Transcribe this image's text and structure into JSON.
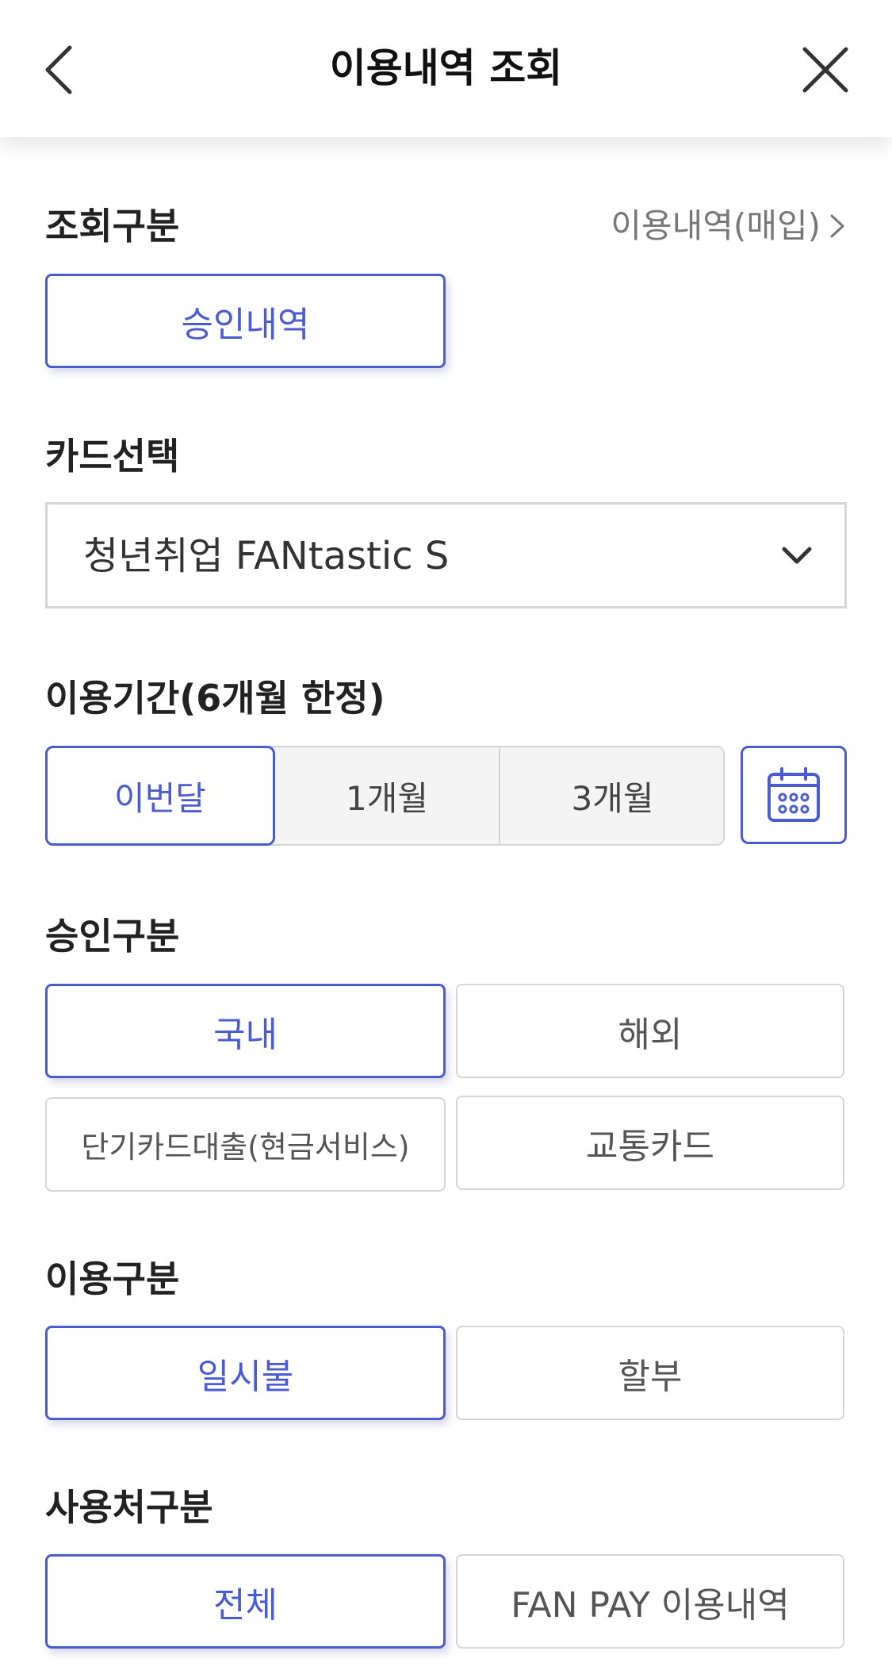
{
  "header": {
    "title": "이용내역 조회",
    "back_icon": "chevron-left-icon",
    "close_icon": "close-icon"
  },
  "inquiry_type": {
    "label": "조회구분",
    "link_label": "이용내역(매입)",
    "link_icon": "chevron-right-icon",
    "options": [
      "승인내역"
    ],
    "selected": "승인내역"
  },
  "card_select": {
    "label": "카드선택",
    "value": "청년취업 FANtastic S",
    "icon": "chevron-down-icon"
  },
  "period": {
    "label": "이용기간(6개월 한정)",
    "options": [
      "이번달",
      "1개월",
      "3개월"
    ],
    "selected": "이번달",
    "calendar_icon": "calendar-icon"
  },
  "approval_type": {
    "label": "승인구분",
    "options": [
      "국내",
      "해외",
      "단기카드대출(현금서비스)",
      "교통카드"
    ],
    "selected": "국내"
  },
  "usage_type": {
    "label": "이용구분",
    "options": [
      "일시불",
      "할부"
    ],
    "selected": "일시불"
  },
  "merchant_type": {
    "label": "사용처구분",
    "options": [
      "전체",
      "FAN PAY 이용내역"
    ],
    "selected": "전체"
  },
  "colors": {
    "accent": "#4b5bd0",
    "border": "#d6d6d6",
    "text": "#222222",
    "muted": "#777777",
    "segment_bg": "#f4f4f4"
  }
}
